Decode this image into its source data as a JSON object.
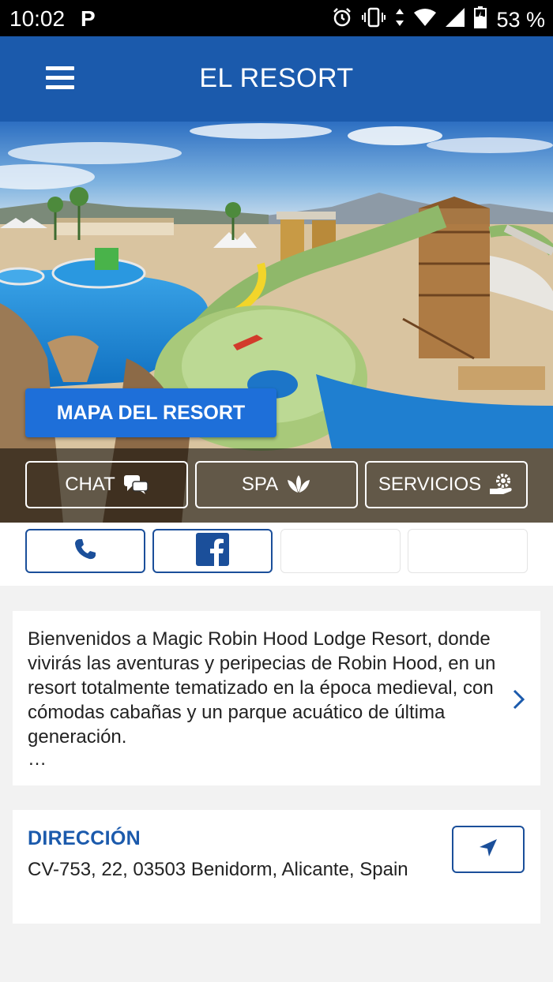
{
  "status_bar": {
    "time": "10:02",
    "app_indicator": "P",
    "battery": "53 %",
    "icons": [
      "alarm-icon",
      "vibrate-icon",
      "data-icon",
      "wifi-icon",
      "signal-icon",
      "battery-icon"
    ]
  },
  "app_bar": {
    "title": "EL RESORT",
    "menu_icon": "hamburger-icon"
  },
  "hero": {
    "map_button": "MAPA DEL RESORT",
    "tabs": [
      {
        "label": "CHAT",
        "icon": "chat-icon"
      },
      {
        "label": "SPA",
        "icon": "lotus-icon"
      },
      {
        "label": "SERVICIOS",
        "icon": "service-hand-icon"
      }
    ]
  },
  "social": {
    "buttons": [
      "phone-icon",
      "facebook-icon"
    ],
    "accent": "#1b4f9a"
  },
  "description": {
    "text": "Bienvenidos a Magic Robin Hood Lodge Resort, donde vivirás las aventuras y peripecias de Robin Hood, en un resort totalmente tematizado en la época medieval, con cómodas cabañas y un parque acuático de última generación.",
    "more": "…"
  },
  "address": {
    "label": "DIRECCIÓN",
    "value": "CV-753, 22, 03503 Benidorm, Alicante, Spain"
  },
  "colors": {
    "primary": "#1b5aac",
    "button": "#1e6fd9"
  }
}
